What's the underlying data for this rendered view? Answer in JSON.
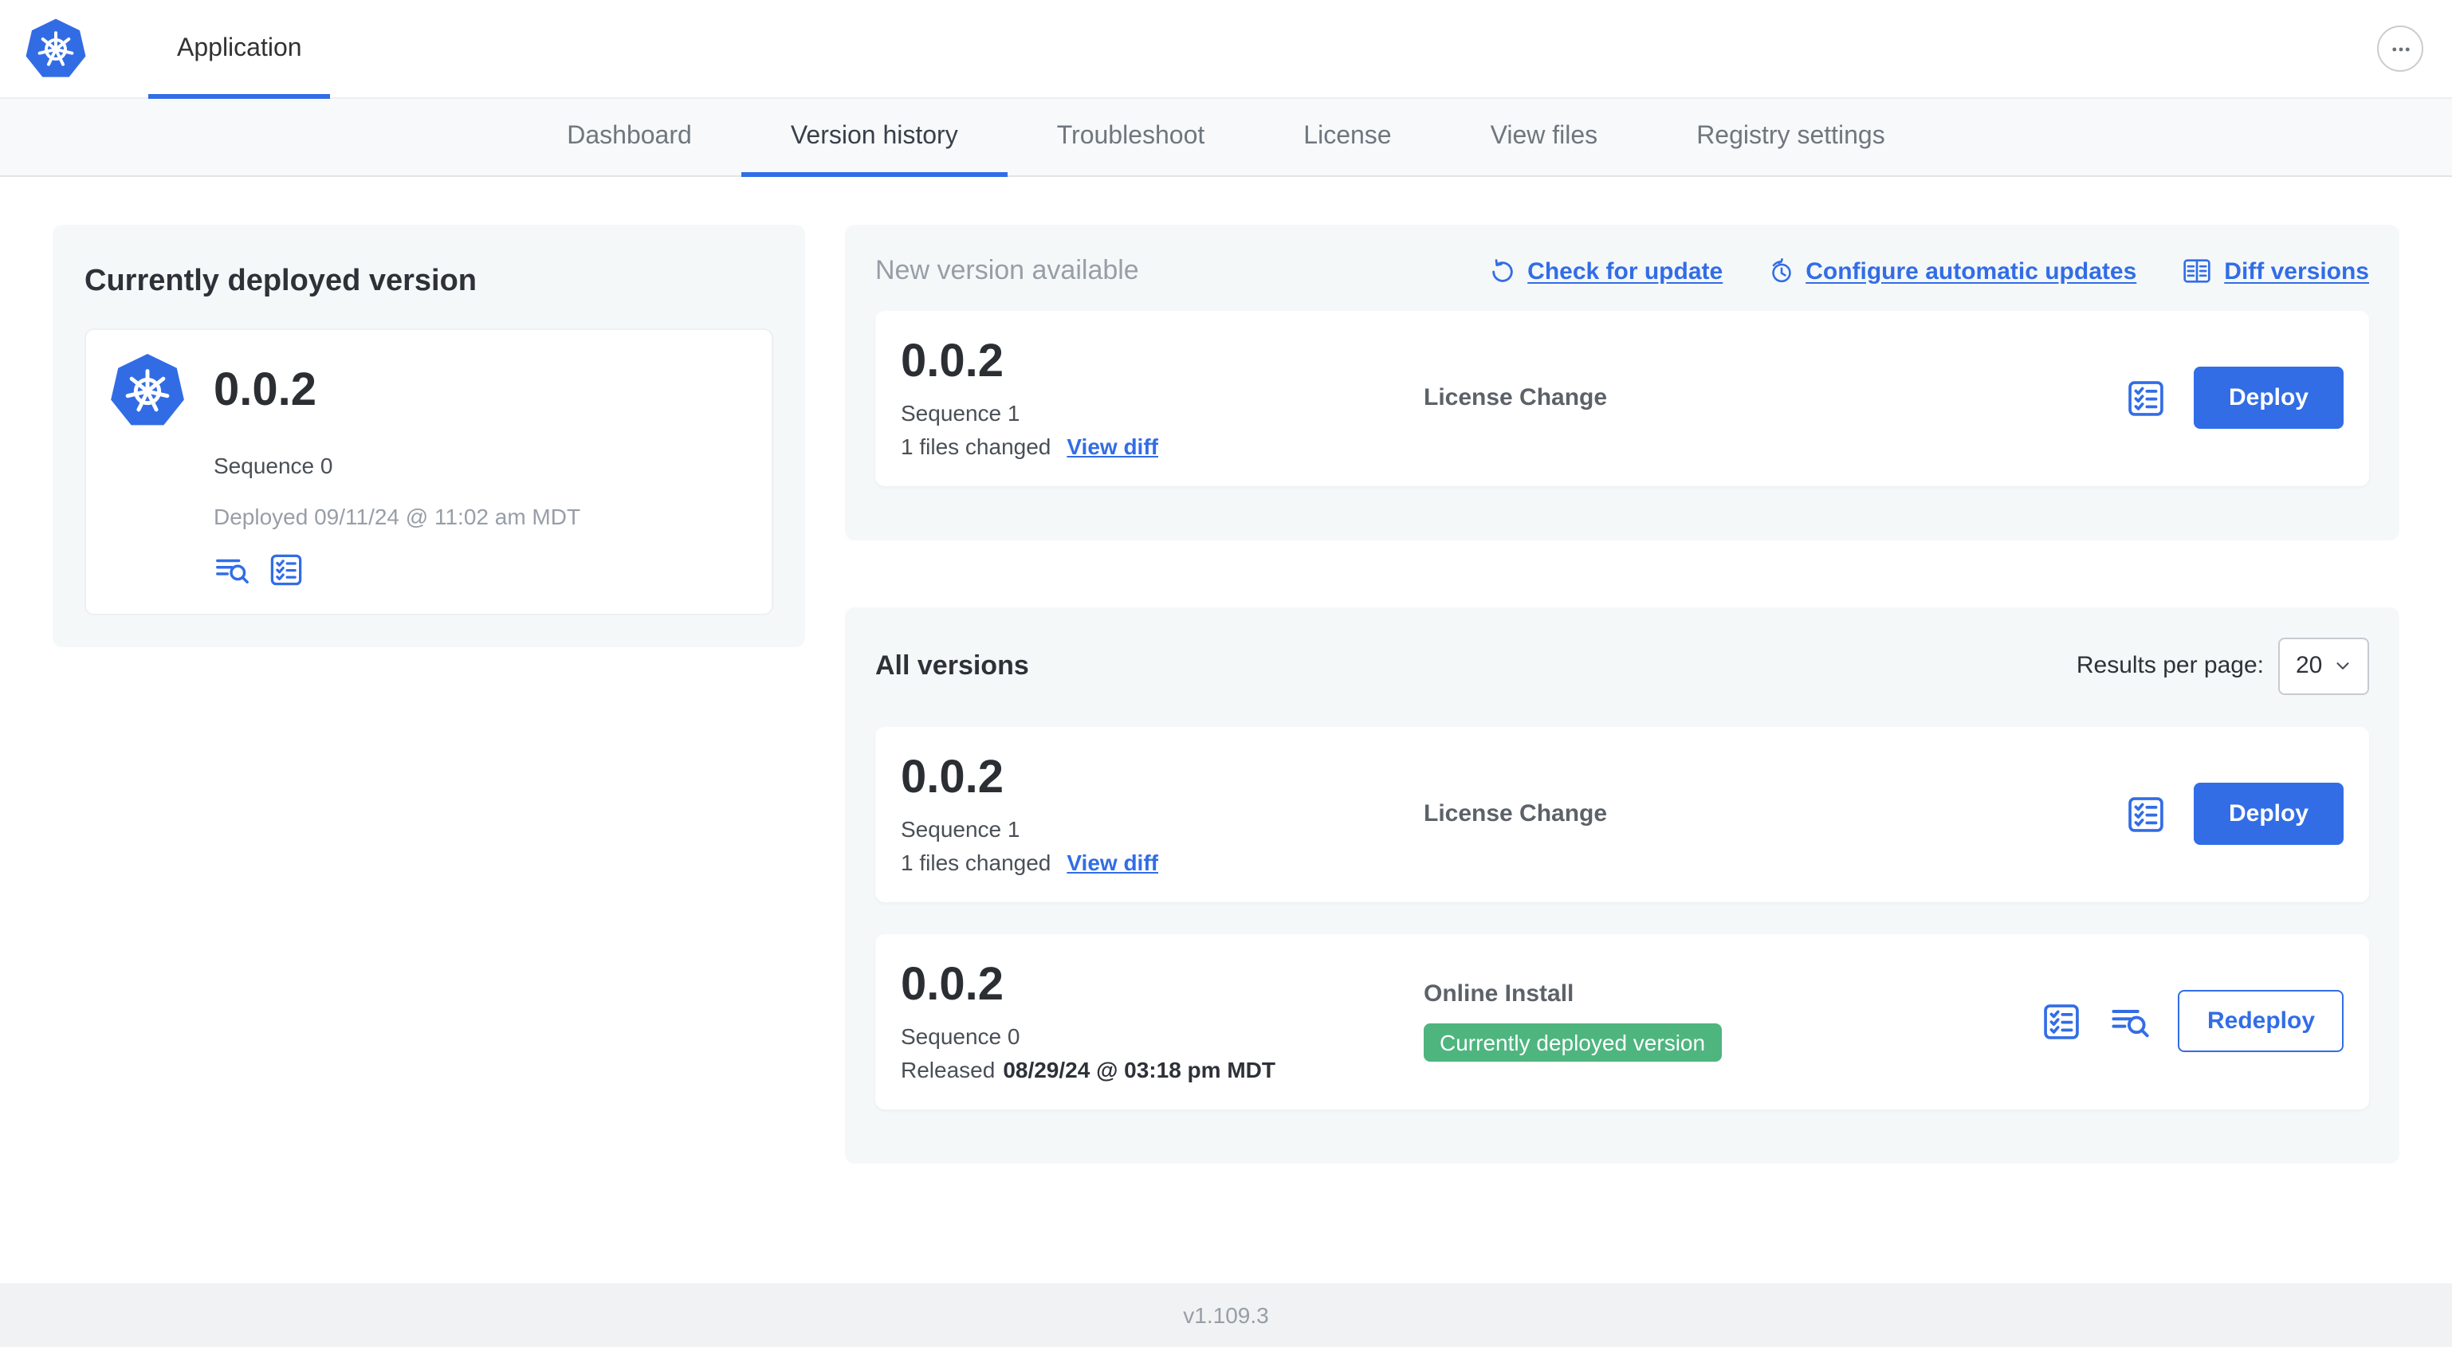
{
  "header": {
    "app_tab": "Application",
    "more_icon": "ellipsis-icon"
  },
  "nav": {
    "tabs": [
      {
        "label": "Dashboard",
        "active": false
      },
      {
        "label": "Version history",
        "active": true
      },
      {
        "label": "Troubleshoot",
        "active": false
      },
      {
        "label": "License",
        "active": false
      },
      {
        "label": "View files",
        "active": false
      },
      {
        "label": "Registry settings",
        "active": false
      }
    ]
  },
  "deployed": {
    "title": "Currently deployed version",
    "version": "0.0.2",
    "sequence": "Sequence 0",
    "deployed_at": "Deployed 09/11/24 @ 11:02 am MDT",
    "icons": [
      "logs-icon",
      "checklist-icon"
    ]
  },
  "new_version": {
    "title": "New version available",
    "actions": [
      {
        "label": "Check for update",
        "icon": "refresh-icon"
      },
      {
        "label": "Configure automatic updates",
        "icon": "schedule-icon"
      },
      {
        "label": "Diff versions",
        "icon": "diff-icon"
      }
    ],
    "card": {
      "version": "0.0.2",
      "sequence": "Sequence 1",
      "changes": "1 files changed",
      "view_diff": "View diff",
      "source": "License Change",
      "deploy_label": "Deploy",
      "icons": [
        "checklist-icon"
      ]
    }
  },
  "all_versions": {
    "title": "All versions",
    "results_per_page_label": "Results per page:",
    "results_per_page_value": "20",
    "rows": [
      {
        "version": "0.0.2",
        "sequence": "Sequence 1",
        "changes": "1 files changed",
        "view_diff": "View diff",
        "source": "License Change",
        "action": "Deploy",
        "icons": [
          "checklist-icon"
        ]
      },
      {
        "version": "0.0.2",
        "sequence": "Sequence 0",
        "released_prefix": "Released",
        "released_date": "08/29/24 @ 03:18 pm MDT",
        "source": "Online Install",
        "badge": "Currently deployed version",
        "action": "Redeploy",
        "icons": [
          "checklist-icon",
          "logs-icon"
        ]
      }
    ]
  },
  "footer": {
    "version": "v1.109.3"
  },
  "colors": {
    "accent": "#326de6",
    "badge_green": "#4eb57f",
    "panel_bg": "#f5f8f9",
    "footer_bg": "#f0f2f3"
  }
}
